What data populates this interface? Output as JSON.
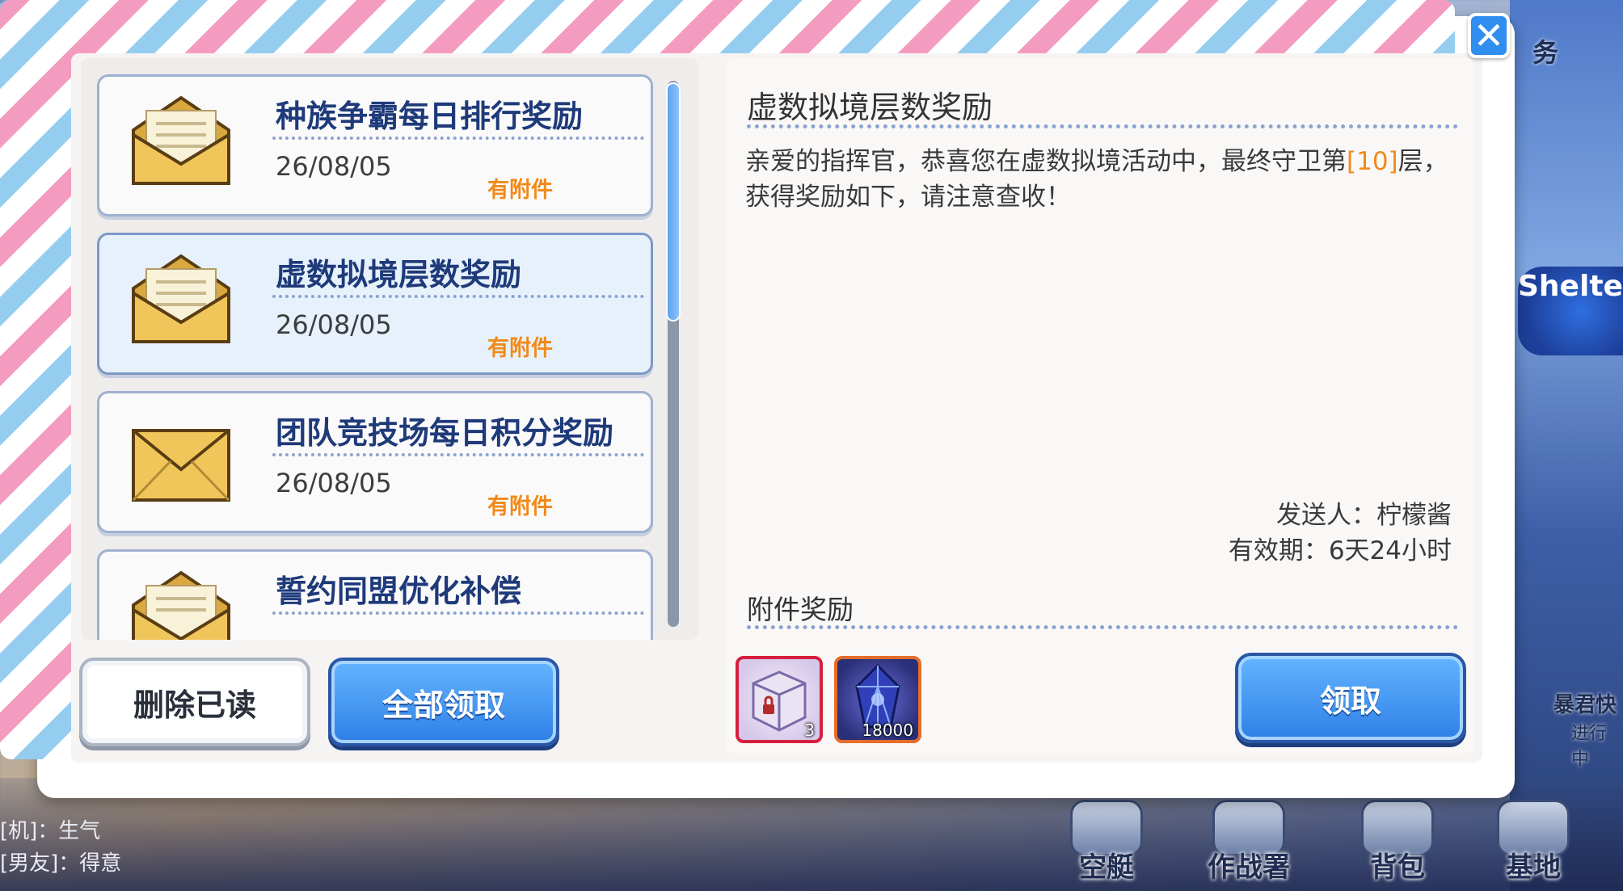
{
  "background": {
    "top_right_tag": "务",
    "shelter_text": "Shelter",
    "side_event_label": "暴君快",
    "side_event_sub": "进行中",
    "chat_lines": [
      "[机]：生气",
      "[男友]：得意"
    ],
    "nav": [
      {
        "label": "空艇",
        "icon": "airship-icon"
      },
      {
        "label": "作战署",
        "icon": "command-icon"
      },
      {
        "label": "背包",
        "icon": "backpack-icon"
      },
      {
        "label": "基地",
        "icon": "base-icon"
      }
    ]
  },
  "mail_list": [
    {
      "title": "种族争霸每日排行奖励",
      "date": "26/08/05",
      "attachment_label": "有附件",
      "opened": true,
      "selected": false
    },
    {
      "title": "虚数拟境层数奖励",
      "date": "26/08/05",
      "attachment_label": "有附件",
      "opened": true,
      "selected": true
    },
    {
      "title": "团队竞技场每日积分奖励",
      "date": "26/08/05",
      "attachment_label": "有附件",
      "opened": false,
      "selected": false
    },
    {
      "title": "誓约同盟优化补偿",
      "date": "",
      "attachment_label": "",
      "opened": true,
      "selected": false
    }
  ],
  "buttons": {
    "delete_read": "删除已读",
    "claim_all": "全部领取",
    "claim": "领取",
    "close": "✕"
  },
  "detail": {
    "title": "虚数拟境层数奖励",
    "body_before": "亲爱的指挥官，恭喜您在虚数拟境活动中，最终守卫第",
    "body_highlight": "[10]",
    "body_after": "层，获得奖励如下，请注意查收！",
    "sender": "发送人：柠檬酱",
    "expire": "有效期：6天24小时",
    "attachments_title": "附件奖励",
    "items": [
      {
        "icon": "locked-crate-icon",
        "count": "3"
      },
      {
        "icon": "blue-crystal-icon",
        "count": "18000"
      }
    ]
  },
  "colors": {
    "accent_blue": "#2f7fe6",
    "highlight_orange": "#f08a1a",
    "title_navy": "#1e3a7a"
  }
}
